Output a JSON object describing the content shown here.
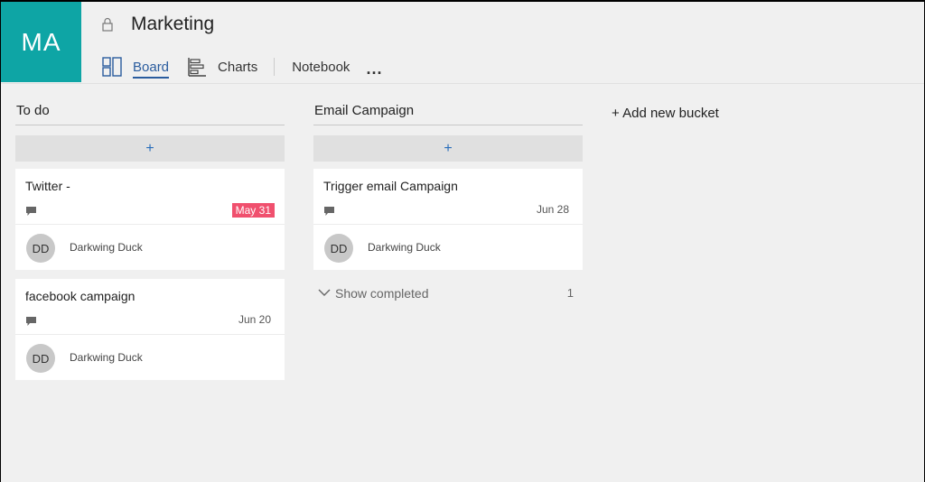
{
  "plan": {
    "initials": "MA",
    "tile_color": "#0ea5a5",
    "title": "Marketing",
    "lock_icon": "lock-icon"
  },
  "nav": {
    "board": "Board",
    "charts": "Charts",
    "notebook": "Notebook",
    "more": "..."
  },
  "buckets": [
    {
      "name": "To do",
      "add_label": "+",
      "tasks": [
        {
          "title": "Twitter -",
          "due": "May 31",
          "overdue": true,
          "assignee_initials": "DD",
          "assignee": "Darkwing Duck"
        },
        {
          "title": "facebook campaign",
          "due": "Jun 20",
          "overdue": false,
          "assignee_initials": "DD",
          "assignee": "Darkwing Duck"
        }
      ]
    },
    {
      "name": "Email Campaign",
      "add_label": "+",
      "tasks": [
        {
          "title": "Trigger email Campaign",
          "due": "Jun 28",
          "overdue": false,
          "assignee_initials": "DD",
          "assignee": "Darkwing Duck"
        }
      ],
      "show_completed": "Show completed",
      "completed_count": "1"
    }
  ],
  "add_bucket": "+ Add new bucket",
  "colors": {
    "accent": "#2a5c9e",
    "overdue": "#f0506e",
    "add_plus": "#2a6ebb"
  }
}
